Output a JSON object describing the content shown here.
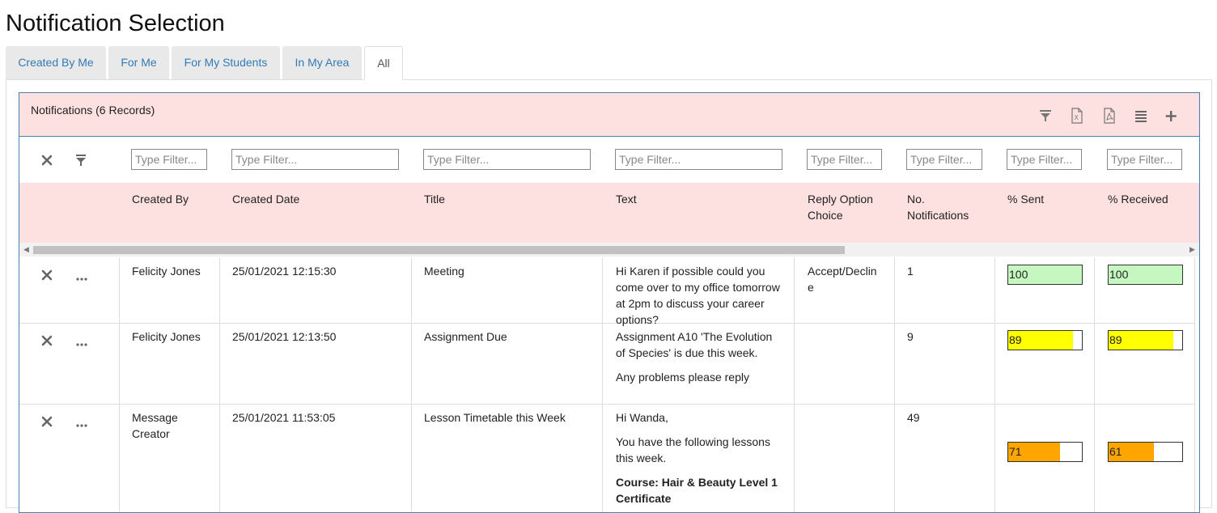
{
  "page_title": "Notification Selection",
  "tabs": [
    {
      "label": "Created By Me"
    },
    {
      "label": "For Me"
    },
    {
      "label": "For My Students"
    },
    {
      "label": "In My Area"
    },
    {
      "label": "All",
      "active": true
    }
  ],
  "grid": {
    "title": "Notifications (6 Records)",
    "toolbar": [
      "filter-icon",
      "excel-export-icon",
      "pdf-export-icon",
      "columns-icon",
      "add-icon"
    ],
    "filter_placeholder": "Type Filter...",
    "columns": [
      "Created By",
      "Created Date",
      "Title",
      "Text",
      "Reply Option Choice",
      "No. Notifications",
      "% Sent",
      "% Received"
    ],
    "rows": [
      {
        "created_by": "Felicity Jones",
        "created_date": "25/01/2021 12:15:30",
        "title": "Meeting",
        "text": [
          "Hi Karen if possible could you come over to my office tomorrow at 2pm to discuss your career options?"
        ],
        "reply_option": "Accept/Decline",
        "no_notifications": "1",
        "sent": "100",
        "received": "100",
        "sent_pct": 100,
        "received_pct": 100
      },
      {
        "created_by": "Felicity Jones",
        "created_date": "25/01/2021 12:13:50",
        "title": "Assignment Due",
        "text": [
          "Assignment A10 'The Evolution of Species' is due this week.",
          "Any problems please reply"
        ],
        "reply_option": "",
        "no_notifications": "9",
        "sent": "89",
        "received": "89",
        "sent_pct": 89,
        "received_pct": 89
      },
      {
        "created_by": "Message Creator",
        "created_date": "25/01/2021 11:53:05",
        "title": "Lesson Timetable this Week",
        "text": [
          "Hi Wanda,",
          "You have the following lessons this week.",
          "Course: Hair & Beauty Level 1 Certificate"
        ],
        "reply_option": "",
        "no_notifications": "49",
        "sent": "71",
        "received": "61",
        "sent_pct": 71,
        "received_pct": 61
      }
    ]
  },
  "colors": {
    "header_bg": "#fde0e0",
    "border_blue": "#4a7fb0",
    "bar_green": "#c6f7c0",
    "bar_yellow": "#ffff00",
    "bar_orange": "#ffa500"
  }
}
